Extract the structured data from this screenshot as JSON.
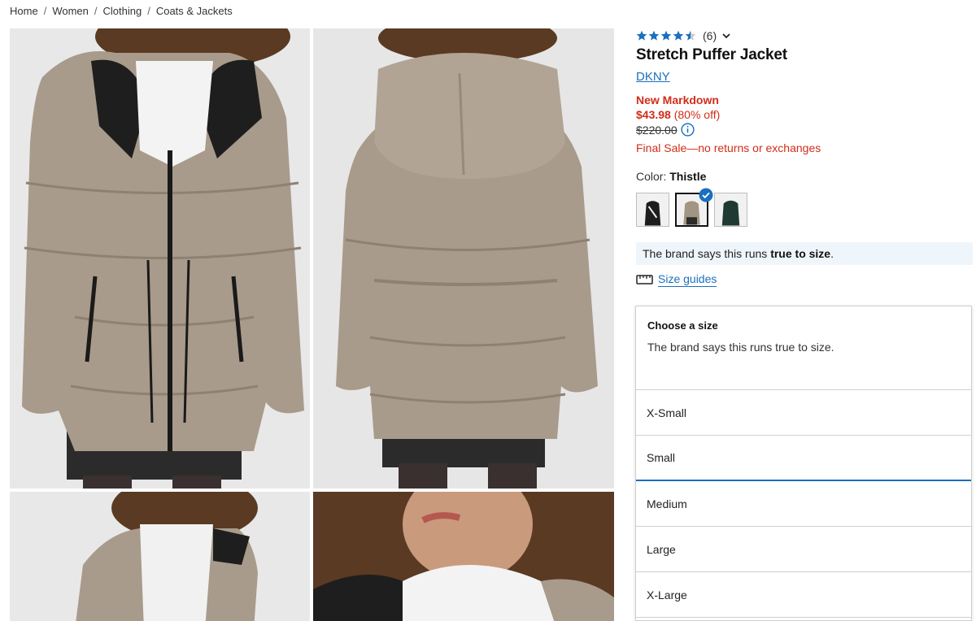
{
  "breadcrumb": [
    "Home",
    "Women",
    "Clothing",
    "Coats & Jackets"
  ],
  "breadcrumb_sep": "/",
  "product": {
    "rating": 4.5,
    "rating_count": "(6)",
    "title": "Stretch Puffer Jacket",
    "brand": "DKNY",
    "markdown_label": "New Markdown",
    "sale_price": "$43.98",
    "discount": "(80% off)",
    "original_price": "$220.00",
    "final_sale": "Final Sale—no returns or exchanges",
    "color_label": "Color:",
    "color_value": "Thistle"
  },
  "swatches": [
    {
      "name": "black",
      "color": "#1d1d1d"
    },
    {
      "name": "thistle",
      "color": "#a39584"
    },
    {
      "name": "dark-green",
      "color": "#1f3a32"
    }
  ],
  "fit_note": {
    "prefix": "The brand says this runs",
    "bold": "true to size",
    "suffix": "."
  },
  "size_guides_label": "Size guides",
  "size_panel": {
    "heading": "Choose a size",
    "description": "The brand says this runs true to size.",
    "options": [
      "X-Small",
      "Small",
      "Medium",
      "Large",
      "X-Large"
    ]
  },
  "colors": {
    "link_blue": "#1a6fc0",
    "sale_red": "#d12d19",
    "jacket": "#a89b8c"
  }
}
